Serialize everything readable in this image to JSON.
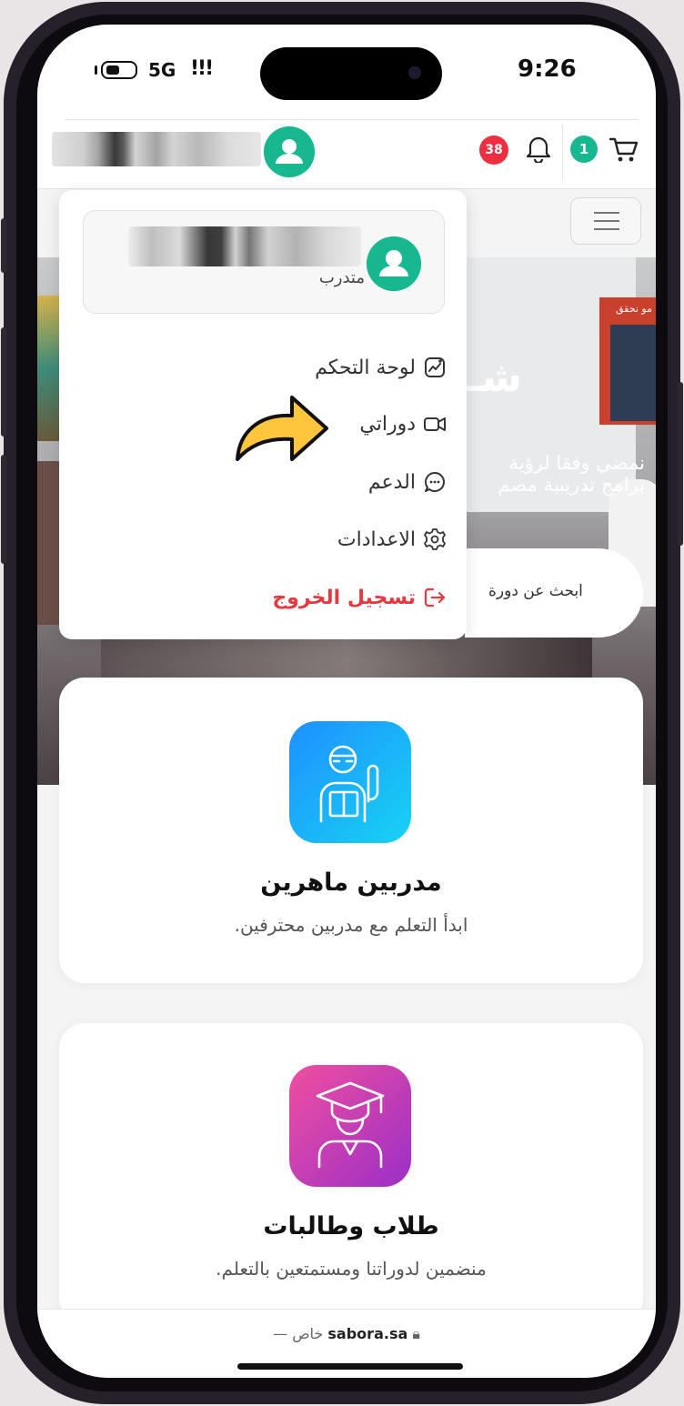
{
  "status_bar": {
    "network": "5G",
    "signal": "!!!",
    "time": "9:26"
  },
  "header": {
    "cart_count": "1",
    "notification_count": "38"
  },
  "hero": {
    "heading": "شـ",
    "text_line1": "نمضي وفقا لرؤية",
    "text_line2": "برامج تدريبية مصم",
    "poster_text": "مو نحقق"
  },
  "search": {
    "placeholder": "ابحث عن دورة"
  },
  "user_menu": {
    "role": "متدرب",
    "items": [
      {
        "label": "لوحة التحكم",
        "icon": "dashboard-icon"
      },
      {
        "label": "دوراتي",
        "icon": "video-icon"
      },
      {
        "label": "الدعم",
        "icon": "chat-icon"
      },
      {
        "label": "الاعدادات",
        "icon": "gear-icon"
      },
      {
        "label": "تسجيل الخروج",
        "icon": "logout-icon"
      }
    ]
  },
  "features": [
    {
      "title": "مدربين ماهرين",
      "subtitle": "ابدأ التعلم مع مدربين محترفين.",
      "icon": "trainer-icon",
      "color_from": "#1e90ff",
      "color_to": "#17d3f2"
    },
    {
      "title": "طلاب وطالبات",
      "subtitle": "منضمين لدوراتنا ومستمتعين بالتعلم.",
      "icon": "graduate-icon",
      "color_from": "#f04fa0",
      "color_to": "#9b2fc7"
    }
  ],
  "browser": {
    "domain": "sabora.sa",
    "label": "— خاص"
  },
  "colors": {
    "brand_green": "#17b890",
    "danger_red": "#e4393f",
    "badge_red": "#ee2f41",
    "arrow_yellow": "#ffc53d"
  }
}
